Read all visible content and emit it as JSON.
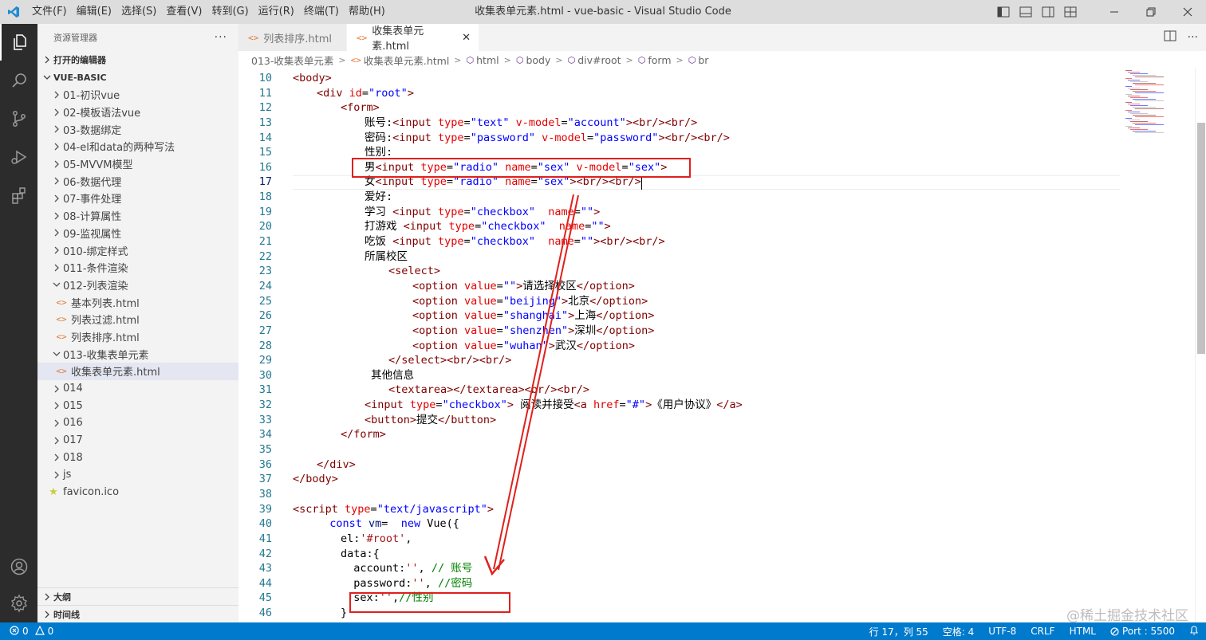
{
  "window": {
    "title": "收集表单元素.html - vue-basic - Visual Studio Code"
  },
  "menu": [
    "文件(F)",
    "编辑(E)",
    "选择(S)",
    "查看(V)",
    "转到(G)",
    "运行(R)",
    "终端(T)",
    "帮助(H)"
  ],
  "sidebar": {
    "title": "资源管理器",
    "more": "···",
    "open_editors": "打开的编辑器",
    "root": "VUE-BASIC",
    "folders": [
      "01-初识vue",
      "02-模板语法vue",
      "03-数据绑定",
      "04-el和data的两种写法",
      "05-MVVM模型",
      "06-数据代理",
      "07-事件处理",
      "08-计算属性",
      "09-监视属性",
      "010-绑定样式",
      "011-条件渲染"
    ],
    "folder_012": "012-列表渲染",
    "files_012": [
      "基本列表.html",
      "列表过滤.html",
      "列表排序.html"
    ],
    "folder_013": "013-收集表单元素",
    "files_013": [
      "收集表单元素.html"
    ],
    "folders_after": [
      "014",
      "015",
      "016",
      "017",
      "018",
      "js"
    ],
    "favicon": "favicon.ico",
    "outline": "大纲",
    "timeline": "时间线"
  },
  "tabs": [
    {
      "label": "列表排序.html",
      "active": false
    },
    {
      "label": "收集表单元素.html",
      "active": true
    }
  ],
  "breadcrumbs": [
    "013-收集表单元素",
    "收集表单元素.html",
    "html",
    "body",
    "div#root",
    "form",
    "br"
  ],
  "code": {
    "current_line": 17,
    "lines": [
      {
        "n": "10",
        "i": 0,
        "s": [
          [
            "t-tag",
            "<body>"
          ]
        ]
      },
      {
        "n": "11",
        "i": 1,
        "s": [
          [
            "t-tag",
            "<div "
          ],
          [
            "t-attr",
            "id"
          ],
          [
            "t-text",
            "="
          ],
          [
            "t-val",
            "\"root\""
          ],
          [
            "t-tag",
            ">"
          ]
        ]
      },
      {
        "n": "12",
        "i": 2,
        "s": [
          [
            "t-tag",
            "<form>"
          ]
        ]
      },
      {
        "n": "13",
        "i": 3,
        "s": [
          [
            "t-text",
            "账号:"
          ],
          [
            "t-tag",
            "<input "
          ],
          [
            "t-attr",
            "type"
          ],
          [
            "t-text",
            "="
          ],
          [
            "t-val",
            "\"text\" "
          ],
          [
            "t-attr",
            "v-model"
          ],
          [
            "t-text",
            "="
          ],
          [
            "t-val",
            "\"account\""
          ],
          [
            "t-tag",
            "><br/><br/>"
          ]
        ]
      },
      {
        "n": "14",
        "i": 3,
        "s": [
          [
            "t-text",
            "密码:"
          ],
          [
            "t-tag",
            "<input "
          ],
          [
            "t-attr",
            "type"
          ],
          [
            "t-text",
            "="
          ],
          [
            "t-val",
            "\"password\" "
          ],
          [
            "t-attr",
            "v-model"
          ],
          [
            "t-text",
            "="
          ],
          [
            "t-val",
            "\"password\""
          ],
          [
            "t-tag",
            "><br/><br/>"
          ]
        ]
      },
      {
        "n": "15",
        "i": 3,
        "s": [
          [
            "t-text",
            "性别:"
          ]
        ]
      },
      {
        "n": "16",
        "i": 3,
        "s": [
          [
            "t-text",
            "男"
          ],
          [
            "t-tag",
            "<input "
          ],
          [
            "t-attr",
            "type"
          ],
          [
            "t-text",
            "="
          ],
          [
            "t-val",
            "\"radio\" "
          ],
          [
            "t-attr",
            "name"
          ],
          [
            "t-text",
            "="
          ],
          [
            "t-val",
            "\"sex\" "
          ],
          [
            "t-attr",
            "v-model"
          ],
          [
            "t-text",
            "="
          ],
          [
            "t-val",
            "\"sex\""
          ],
          [
            "t-tag",
            ">"
          ]
        ]
      },
      {
        "n": "17",
        "i": 3,
        "s": [
          [
            "t-text",
            "女"
          ],
          [
            "t-tag",
            "<input "
          ],
          [
            "t-attr",
            "type"
          ],
          [
            "t-text",
            "="
          ],
          [
            "t-val",
            "\"radio\" "
          ],
          [
            "t-attr",
            "name"
          ],
          [
            "t-text",
            "="
          ],
          [
            "t-val",
            "\"sex\""
          ],
          [
            "t-tag",
            "><br/><br/>"
          ]
        ]
      },
      {
        "n": "18",
        "i": 3,
        "s": [
          [
            "t-text",
            "爱好:"
          ]
        ]
      },
      {
        "n": "19",
        "i": 3,
        "s": [
          [
            "t-text",
            "学习 "
          ],
          [
            "t-tag",
            "<input "
          ],
          [
            "t-attr",
            "type"
          ],
          [
            "t-text",
            "="
          ],
          [
            "t-val",
            "\"checkbox\"  "
          ],
          [
            "t-attr",
            "name"
          ],
          [
            "t-text",
            "="
          ],
          [
            "t-val",
            "\"\""
          ],
          [
            "t-tag",
            ">"
          ]
        ]
      },
      {
        "n": "20",
        "i": 3,
        "s": [
          [
            "t-text",
            "打游戏 "
          ],
          [
            "t-tag",
            "<input "
          ],
          [
            "t-attr",
            "type"
          ],
          [
            "t-text",
            "="
          ],
          [
            "t-val",
            "\"checkbox\"  "
          ],
          [
            "t-attr",
            "name"
          ],
          [
            "t-text",
            "="
          ],
          [
            "t-val",
            "\"\""
          ],
          [
            "t-tag",
            ">"
          ]
        ]
      },
      {
        "n": "21",
        "i": 3,
        "s": [
          [
            "t-text",
            "吃饭 "
          ],
          [
            "t-tag",
            "<input "
          ],
          [
            "t-attr",
            "type"
          ],
          [
            "t-text",
            "="
          ],
          [
            "t-val",
            "\"checkbox\"  "
          ],
          [
            "t-attr",
            "name"
          ],
          [
            "t-text",
            "="
          ],
          [
            "t-val",
            "\"\""
          ],
          [
            "t-tag",
            "><br/><br/>"
          ]
        ]
      },
      {
        "n": "22",
        "i": 3,
        "s": [
          [
            "t-text",
            "所属校区"
          ]
        ]
      },
      {
        "n": "23",
        "i": 4,
        "s": [
          [
            "t-tag",
            "<select>"
          ]
        ]
      },
      {
        "n": "24",
        "i": 5,
        "s": [
          [
            "t-tag",
            "<option "
          ],
          [
            "t-attr",
            "value"
          ],
          [
            "t-text",
            "="
          ],
          [
            "t-val",
            "\"\""
          ],
          [
            "t-tag",
            ">"
          ],
          [
            "t-text",
            "请选择校区"
          ],
          [
            "t-tag",
            "</option>"
          ]
        ]
      },
      {
        "n": "25",
        "i": 5,
        "s": [
          [
            "t-tag",
            "<option "
          ],
          [
            "t-attr",
            "value"
          ],
          [
            "t-text",
            "="
          ],
          [
            "t-val",
            "\"beijing\""
          ],
          [
            "t-tag",
            ">"
          ],
          [
            "t-text",
            "北京"
          ],
          [
            "t-tag",
            "</option>"
          ]
        ]
      },
      {
        "n": "26",
        "i": 5,
        "s": [
          [
            "t-tag",
            "<option "
          ],
          [
            "t-attr",
            "value"
          ],
          [
            "t-text",
            "="
          ],
          [
            "t-val",
            "\"shanghai\""
          ],
          [
            "t-tag",
            ">"
          ],
          [
            "t-text",
            "上海"
          ],
          [
            "t-tag",
            "</option>"
          ]
        ]
      },
      {
        "n": "27",
        "i": 5,
        "s": [
          [
            "t-tag",
            "<option "
          ],
          [
            "t-attr",
            "value"
          ],
          [
            "t-text",
            "="
          ],
          [
            "t-val",
            "\"shenzhen\""
          ],
          [
            "t-tag",
            ">"
          ],
          [
            "t-text",
            "深圳"
          ],
          [
            "t-tag",
            "</option>"
          ]
        ]
      },
      {
        "n": "28",
        "i": 5,
        "s": [
          [
            "t-tag",
            "<option "
          ],
          [
            "t-attr",
            "value"
          ],
          [
            "t-text",
            "="
          ],
          [
            "t-val",
            "\"wuhan\""
          ],
          [
            "t-tag",
            ">"
          ],
          [
            "t-text",
            "武汉"
          ],
          [
            "t-tag",
            "</option>"
          ]
        ]
      },
      {
        "n": "29",
        "i": 4,
        "s": [
          [
            "t-tag",
            "</select><br/><br/>"
          ]
        ]
      },
      {
        "n": "30",
        "i": 3,
        "s": [
          [
            "t-text",
            " 其他信息"
          ]
        ]
      },
      {
        "n": "31",
        "i": 4,
        "s": [
          [
            "t-tag",
            "<textarea></textarea><br/><br/>"
          ]
        ]
      },
      {
        "n": "32",
        "i": 3,
        "s": [
          [
            "t-tag",
            "<input "
          ],
          [
            "t-attr",
            "type"
          ],
          [
            "t-text",
            "="
          ],
          [
            "t-val",
            "\"checkbox\""
          ],
          [
            "t-tag",
            ">"
          ],
          [
            "t-text",
            " 阅读并接受"
          ],
          [
            "t-tag",
            "<a "
          ],
          [
            "t-attr",
            "href"
          ],
          [
            "t-text",
            "="
          ],
          [
            "t-val",
            "\"#\""
          ],
          [
            "t-tag",
            ">"
          ],
          [
            "t-text",
            "《用户协议》"
          ],
          [
            "t-tag",
            "</a>"
          ]
        ]
      },
      {
        "n": "33",
        "i": 3,
        "s": [
          [
            "t-tag",
            "<button>"
          ],
          [
            "t-text",
            "提交"
          ],
          [
            "t-tag",
            "</button>"
          ]
        ]
      },
      {
        "n": "34",
        "i": 2,
        "s": [
          [
            "t-tag",
            "</form>"
          ]
        ]
      },
      {
        "n": "35",
        "i": 0,
        "s": []
      },
      {
        "n": "36",
        "i": 1,
        "s": [
          [
            "t-tag",
            "</div>"
          ]
        ]
      },
      {
        "n": "37",
        "i": 0,
        "s": [
          [
            "t-tag",
            "</body>"
          ]
        ]
      },
      {
        "n": "38",
        "i": 0,
        "s": []
      },
      {
        "n": "39",
        "i": 0,
        "s": [
          [
            "t-tag",
            "<script "
          ],
          [
            "t-attr",
            "type"
          ],
          [
            "t-text",
            "="
          ],
          [
            "t-val",
            "\"text/javascript\""
          ],
          [
            "t-tag",
            ">"
          ]
        ]
      },
      {
        "n": "40",
        "i": 1,
        "s": [
          [
            "t-kw",
            "  const "
          ],
          [
            "t-var",
            "vm"
          ],
          [
            "t-text",
            "=  "
          ],
          [
            "t-kw",
            "new "
          ],
          [
            "t-text",
            "Vue({"
          ]
        ]
      },
      {
        "n": "41",
        "i": 2,
        "s": [
          [
            "t-text",
            "el:"
          ],
          [
            "t-str",
            "'#root'"
          ],
          [
            "t-text",
            ","
          ]
        ]
      },
      {
        "n": "42",
        "i": 2,
        "s": [
          [
            "t-text",
            "data:{"
          ]
        ]
      },
      {
        "n": "43",
        "i": 2,
        "s": [
          [
            "t-text",
            "  account:"
          ],
          [
            "t-str",
            "''"
          ],
          [
            "t-text",
            ", "
          ],
          [
            "t-com",
            "// 账号"
          ]
        ]
      },
      {
        "n": "44",
        "i": 2,
        "s": [
          [
            "t-text",
            "  password:"
          ],
          [
            "t-str",
            "''"
          ],
          [
            "t-text",
            ", "
          ],
          [
            "t-com",
            "//密码"
          ]
        ]
      },
      {
        "n": "45",
        "i": 2,
        "s": [
          [
            "t-text",
            "  sex:"
          ],
          [
            "t-str",
            "''"
          ],
          [
            "t-text",
            ","
          ],
          [
            "t-com",
            "//性别"
          ]
        ]
      },
      {
        "n": "46",
        "i": 2,
        "s": [
          [
            "t-text",
            "}"
          ]
        ]
      }
    ]
  },
  "status": {
    "errors": "0",
    "warnings": "0",
    "position": "行 17，列 55",
    "spaces": "空格: 4",
    "encoding": "UTF-8",
    "eol": "CRLF",
    "language": "HTML",
    "port": "Port : 5500"
  },
  "watermark": "@稀土掘金技术社区",
  "colors": {
    "activity_bar": "#2c2c2c",
    "status_bar": "#007acc",
    "annotation": "#e0201c"
  }
}
